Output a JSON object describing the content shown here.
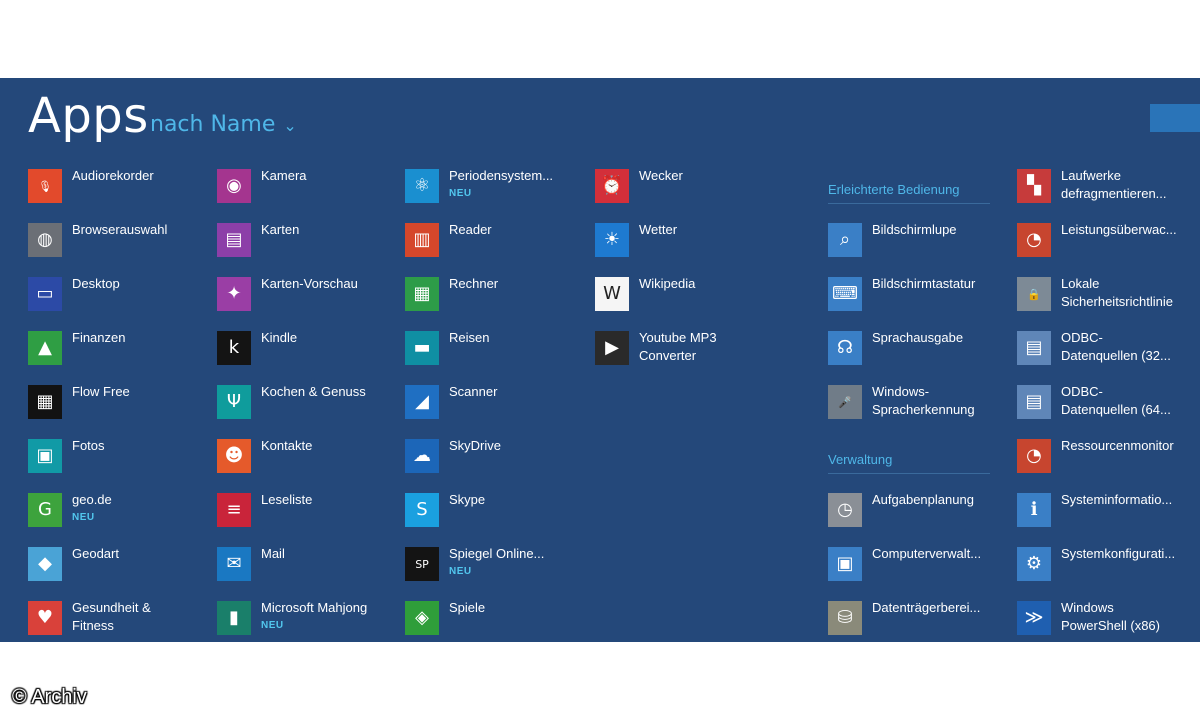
{
  "header": {
    "title": "Apps",
    "sort_label": "nach Name",
    "sort_icon": "chevron-down-icon"
  },
  "colors": {
    "background": "#24487a",
    "accent": "#4fb7e8",
    "badge": "#52c7ee"
  },
  "columns": [
    {
      "items": [
        {
          "l1": "Audiorekorder",
          "color": "#e24a2c",
          "icon": "microphone-icon",
          "glyph": "🎙"
        },
        {
          "l1": "Browserauswahl",
          "color": "#6b6f76",
          "icon": "globe-icon",
          "glyph": "◍"
        },
        {
          "l1": "Desktop",
          "color": "#2c4aa6",
          "icon": "desktop-icon",
          "glyph": "▭"
        },
        {
          "l1": "Finanzen",
          "color": "#2f9e44",
          "icon": "finance-chart-icon",
          "glyph": "▲"
        },
        {
          "l1": "Flow Free",
          "color": "#121212",
          "icon": "flow-free-icon",
          "glyph": "▦"
        },
        {
          "l1": "Fotos",
          "color": "#119aa6",
          "icon": "photos-icon",
          "glyph": "▣"
        },
        {
          "l1": "geo.de",
          "color": "#3da33d",
          "badge": "NEU",
          "icon": "geo-icon",
          "glyph": "G"
        },
        {
          "l1": "Geodart",
          "color": "#4aa3d6",
          "icon": "geodart-icon",
          "glyph": "◆"
        },
        {
          "l1": "Gesundheit &",
          "l2": "Fitness",
          "color": "#d9413a",
          "icon": "health-heart-icon",
          "glyph": "♥"
        }
      ]
    },
    {
      "items": [
        {
          "l1": "Kamera",
          "color": "#a4358f",
          "icon": "camera-icon",
          "glyph": "◉"
        },
        {
          "l1": "Karten",
          "color": "#8c3fa8",
          "icon": "maps-icon",
          "glyph": "▤"
        },
        {
          "l1": "Karten-Vorschau",
          "color": "#9a3ea5",
          "icon": "maps-preview-icon",
          "glyph": "✦"
        },
        {
          "l1": "Kindle",
          "color": "#141414",
          "icon": "kindle-icon",
          "glyph": "k"
        },
        {
          "l1": "Kochen & Genuss",
          "color": "#0f9c9c",
          "icon": "cooking-icon",
          "glyph": "Ψ"
        },
        {
          "l1": "Kontakte",
          "color": "#e55a2b",
          "icon": "contacts-icon",
          "glyph": "☻"
        },
        {
          "l1": "Leseliste",
          "color": "#c9243a",
          "icon": "reading-list-icon",
          "glyph": "≡"
        },
        {
          "l1": "Mail",
          "color": "#1a78c2",
          "icon": "mail-icon",
          "glyph": "✉"
        },
        {
          "l1": "Microsoft Mahjong",
          "color": "#1a7f6a",
          "badge": "NEU",
          "icon": "mahjong-icon",
          "glyph": "▮"
        }
      ]
    },
    {
      "items": [
        {
          "l1": "Periodensystem...",
          "color": "#1a8fd0",
          "badge": "NEU",
          "icon": "atom-icon",
          "glyph": "⚛"
        },
        {
          "l1": "Reader",
          "color": "#d5472b",
          "icon": "reader-icon",
          "glyph": "▥"
        },
        {
          "l1": "Rechner",
          "color": "#2d9c48",
          "icon": "calculator-icon",
          "glyph": "▦"
        },
        {
          "l1": "Reisen",
          "color": "#0f8fa3",
          "icon": "travel-icon",
          "glyph": "▬"
        },
        {
          "l1": "Scanner",
          "color": "#1f6fc2",
          "icon": "scanner-icon",
          "glyph": "◢"
        },
        {
          "l1": "SkyDrive",
          "color": "#1c66b8",
          "icon": "cloud-icon",
          "glyph": "☁"
        },
        {
          "l1": "Skype",
          "color": "#1aa0e0",
          "icon": "skype-icon",
          "glyph": "S"
        },
        {
          "l1": "Spiegel Online...",
          "color": "#141414",
          "badge": "NEU",
          "icon": "spiegel-icon",
          "glyph": "SP"
        },
        {
          "l1": "Spiele",
          "color": "#2f9e3a",
          "icon": "gamepad-icon",
          "glyph": "◈"
        }
      ]
    },
    {
      "items": [
        {
          "l1": "Wecker",
          "color": "#d32f3a",
          "icon": "alarm-clock-icon",
          "glyph": "⏰"
        },
        {
          "l1": "Wetter",
          "color": "#1e7ad0",
          "icon": "sun-icon",
          "glyph": "☀"
        },
        {
          "l1": "Wikipedia",
          "color": "#f5f5f5",
          "icon": "wikipedia-icon",
          "glyph": "W"
        },
        {
          "l1": "Youtube MP3",
          "l2": "Converter",
          "color": "#2a2a2a",
          "icon": "youtube-icon",
          "glyph": "▶"
        }
      ]
    }
  ],
  "groups": {
    "accessibility": {
      "title": "Erleichterte Bedienung",
      "items": [
        {
          "l1": "Bildschirmlupe",
          "color": "#3a7fc6",
          "icon": "magnifier-icon",
          "glyph": "⌕"
        },
        {
          "l1": "Bildschirmtastatur",
          "color": "#3a7fc6",
          "icon": "keyboard-icon",
          "glyph": "⌨"
        },
        {
          "l1": "Sprachausgabe",
          "color": "#3a7fc6",
          "icon": "narrator-icon",
          "glyph": "☊"
        },
        {
          "l1": "Windows-",
          "l2": "Spracherkennung",
          "color": "#707c88",
          "icon": "speech-recognition-icon",
          "glyph": "🎤"
        }
      ]
    },
    "admin": {
      "title": "Verwaltung",
      "items": [
        {
          "l1": "Aufgabenplanung",
          "color": "#8a8f96",
          "icon": "task-scheduler-icon",
          "glyph": "◷"
        },
        {
          "l1": "Computerverwalt...",
          "color": "#3a7fc6",
          "icon": "computer-management-icon",
          "glyph": "▣"
        },
        {
          "l1": "Datenträgerberei...",
          "color": "#8a8a7a",
          "icon": "disk-cleanup-icon",
          "glyph": "⛁"
        }
      ]
    }
  },
  "tools": {
    "items": [
      {
        "l1": "Laufwerke",
        "l2": "defragmentieren...",
        "color": "#c63b3b",
        "icon": "defrag-icon",
        "glyph": "▚"
      },
      {
        "l1": "Leistungsüberwac...",
        "color": "#c7452f",
        "icon": "performance-monitor-icon",
        "glyph": "◔"
      },
      {
        "l1": "Lokale",
        "l2": "Sicherheitsrichtlinie",
        "color": "#7d8a96",
        "icon": "security-policy-icon",
        "glyph": "🔒"
      },
      {
        "l1": "ODBC-",
        "l2": "Datenquellen (32...",
        "color": "#5f86b8",
        "icon": "odbc-icon",
        "glyph": "▤"
      },
      {
        "l1": "ODBC-",
        "l2": "Datenquellen (64...",
        "color": "#5f86b8",
        "icon": "odbc-64-icon",
        "glyph": "▤"
      },
      {
        "l1": "Ressourcenmonitor",
        "color": "#c7452f",
        "icon": "resource-monitor-icon",
        "glyph": "◔"
      },
      {
        "l1": "Systeminformatio...",
        "color": "#3a7fc6",
        "icon": "system-info-icon",
        "glyph": "ℹ"
      },
      {
        "l1": "Systemkonfigurati...",
        "color": "#3a7fc6",
        "icon": "system-config-icon",
        "glyph": "⚙"
      },
      {
        "l1": "Windows",
        "l2": "PowerShell (x86)",
        "color": "#1f5fb0",
        "icon": "powershell-icon",
        "glyph": "≫"
      }
    ]
  },
  "footer": {
    "copyright": "© Archiv"
  }
}
